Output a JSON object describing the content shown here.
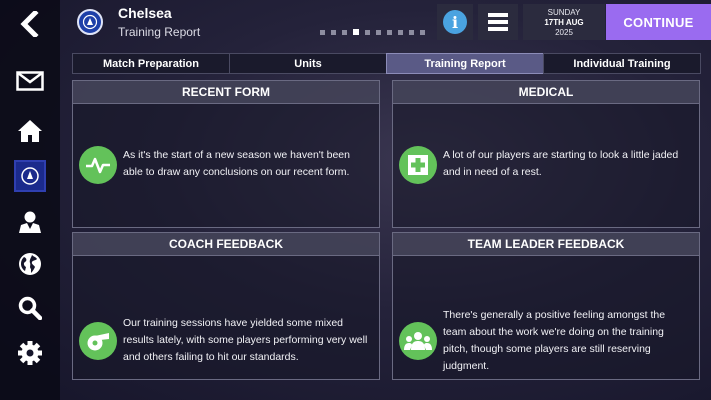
{
  "header": {
    "club_name": "Chelsea",
    "page_subtitle": "Training Report",
    "date_day": "SUNDAY",
    "date_main": "17TH AUG",
    "date_year": "2025",
    "continue_label": "CONTINUE",
    "page_dots": 10,
    "active_dot": 3
  },
  "sidebar": {
    "items": [
      {
        "icon": "back-arrow-icon"
      },
      {
        "icon": "mail-icon"
      },
      {
        "icon": "home-icon"
      },
      {
        "icon": "club-badge-icon"
      },
      {
        "icon": "person-icon"
      },
      {
        "icon": "globe-icon"
      },
      {
        "icon": "search-icon"
      },
      {
        "icon": "settings-gear-icon"
      }
    ]
  },
  "tabs": [
    {
      "label": "Match Preparation",
      "active": false
    },
    {
      "label": "Units",
      "active": false
    },
    {
      "label": "Training Report",
      "active": true
    },
    {
      "label": "Individual Training",
      "active": false
    }
  ],
  "cards": {
    "recent_form": {
      "title": "RECENT FORM",
      "text": "As it's the start of a new season we haven't been able to draw any conclusions on our recent form.",
      "icon": "pulse-icon"
    },
    "medical": {
      "title": "MEDICAL",
      "text": "A lot of our players are starting to look a little jaded and in need of a rest.",
      "icon": "medical-cross-icon"
    },
    "coach_feedback": {
      "title": "COACH FEEDBACK",
      "text": "Our training sessions have yielded some mixed results lately, with some players performing very well and others failing to hit our standards.",
      "icon": "whistle-icon"
    },
    "team_leader_feedback": {
      "title": "TEAM LEADER FEEDBACK",
      "text": "There's generally a positive feeling amongst the team about the work we're doing on the training pitch, though some players are still reserving judgment.",
      "icon": "group-icon"
    }
  },
  "colors": {
    "accent": "#9a6bf0",
    "icon_green": "#63c25a",
    "info_blue": "#4aa3e0"
  }
}
